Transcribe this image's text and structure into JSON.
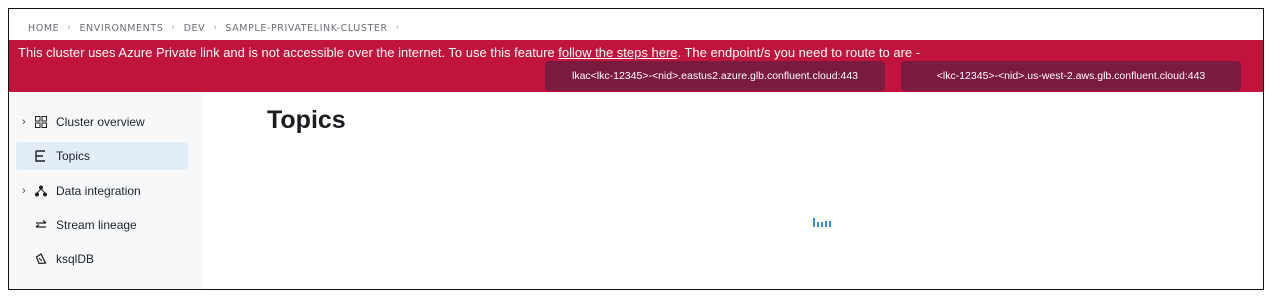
{
  "breadcrumb": {
    "items": [
      "HOME",
      "ENVIRONMENTS",
      "DEV",
      "SAMPLE-PRIVATELINK-CLUSTER"
    ],
    "separator": "›"
  },
  "banner": {
    "message_before_link": "This cluster uses Azure Private link and is not accessible over the internet. To use this feature ",
    "link_text": "follow the steps here",
    "message_after_link": ". The endpoint/s you need to route to are -",
    "endpoints": [
      "lkac<lkc-12345>-<nid>.eastus2.azure.glb.confluent.cloud:443",
      "<lkc-12345>-<nid>.us-west-2.aws.glb.confluent.cloud:443"
    ],
    "background_color": "#c0143c",
    "endpoint_color": "#7b1a3f"
  },
  "sidebar": {
    "items": [
      {
        "label": "Cluster overview",
        "icon": "grid-icon",
        "expandable": true,
        "active": false
      },
      {
        "label": "Topics",
        "icon": "topics-icon",
        "expandable": false,
        "active": true
      },
      {
        "label": "Data integration",
        "icon": "connector-icon",
        "expandable": true,
        "active": false
      },
      {
        "label": "Stream lineage",
        "icon": "lineage-icon",
        "expandable": false,
        "active": false
      },
      {
        "label": "ksqlDB",
        "icon": "ksqldb-icon",
        "expandable": false,
        "active": false
      }
    ]
  },
  "main": {
    "title": "Topics",
    "loading": true,
    "loader_color": "#3a8fd9"
  }
}
